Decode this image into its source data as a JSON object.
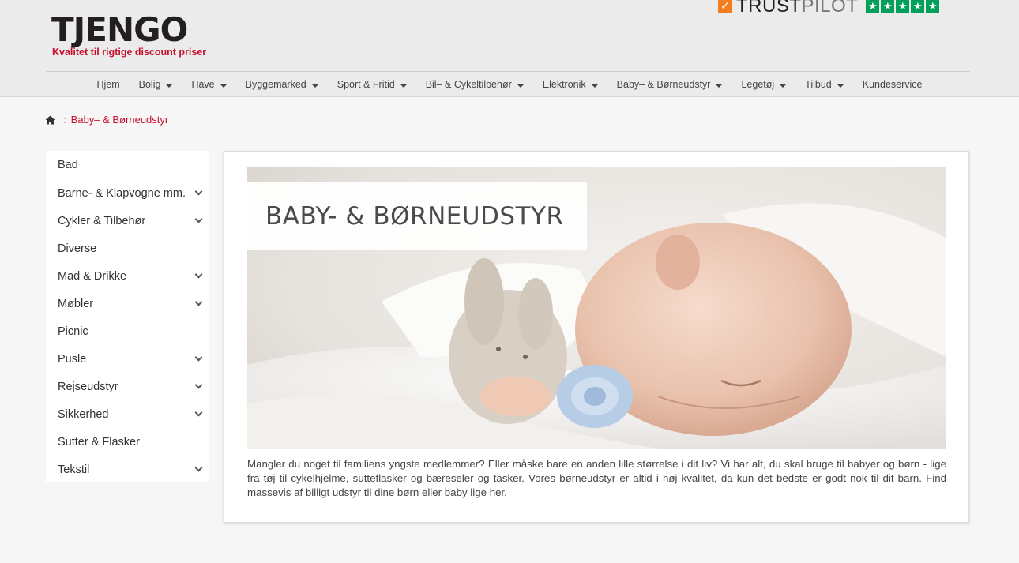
{
  "brand": {
    "name": "TJENGO",
    "tagline": "Kvalitet til rigtige discount priser"
  },
  "trustpilot": {
    "label_bold": "TRUST",
    "label_light": "PILOT",
    "stars": 5,
    "icon": "trustpilot-check-icon",
    "colors": {
      "check": "#f47d20",
      "stars": "#00a05a"
    }
  },
  "nav": {
    "items": [
      {
        "label": "Hjem",
        "has_dropdown": false
      },
      {
        "label": "Bolig",
        "has_dropdown": true
      },
      {
        "label": "Have",
        "has_dropdown": true
      },
      {
        "label": "Byggemarked",
        "has_dropdown": true
      },
      {
        "label": "Sport & Fritid",
        "has_dropdown": true
      },
      {
        "label": "Bil– & Cykeltilbehør",
        "has_dropdown": true
      },
      {
        "label": "Elektronik",
        "has_dropdown": true
      },
      {
        "label": "Baby– & Børneudstyr",
        "has_dropdown": true
      },
      {
        "label": "Legetøj",
        "has_dropdown": true
      },
      {
        "label": "Tilbud",
        "has_dropdown": true
      },
      {
        "label": "Kundeservice",
        "has_dropdown": false
      }
    ]
  },
  "breadcrumb": {
    "home_icon": "home-icon",
    "separator": "::",
    "current": "Baby– & Børneudstyr"
  },
  "sidebar": {
    "items": [
      {
        "label": "Bad",
        "expandable": false
      },
      {
        "label": "Barne- & Klapvogne mm.",
        "expandable": true
      },
      {
        "label": "Cykler & Tilbehør",
        "expandable": true
      },
      {
        "label": "Diverse",
        "expandable": false
      },
      {
        "label": "Mad & Drikke",
        "expandable": true
      },
      {
        "label": "Møbler",
        "expandable": true
      },
      {
        "label": "Picnic",
        "expandable": false
      },
      {
        "label": "Pusle",
        "expandable": true
      },
      {
        "label": "Rejseudstyr",
        "expandable": true
      },
      {
        "label": "Sikkerhed",
        "expandable": true
      },
      {
        "label": "Sutter & Flasker",
        "expandable": false
      },
      {
        "label": "Tekstil",
        "expandable": true
      }
    ]
  },
  "main": {
    "hero_title": "BABY- & BØRNEUDSTYR",
    "description": "Mangler du noget til familiens yngste medlemmer? Eller måske bare en anden lille størrelse i dit liv? Vi har alt, du skal bruge til babyer og børn - lige fra tøj til cykelhjelme, sutteflasker og bæreseler og tasker. Vores børneudstyr er altid i høj kvalitet, da kun det bedste er godt nok til dit barn. Find massevis af billigt udstyr til dine børn eller baby lige her."
  },
  "colors": {
    "accent": "#c8102e",
    "header_bg": "#ebebeb",
    "page_bg": "#f6f6f6"
  }
}
